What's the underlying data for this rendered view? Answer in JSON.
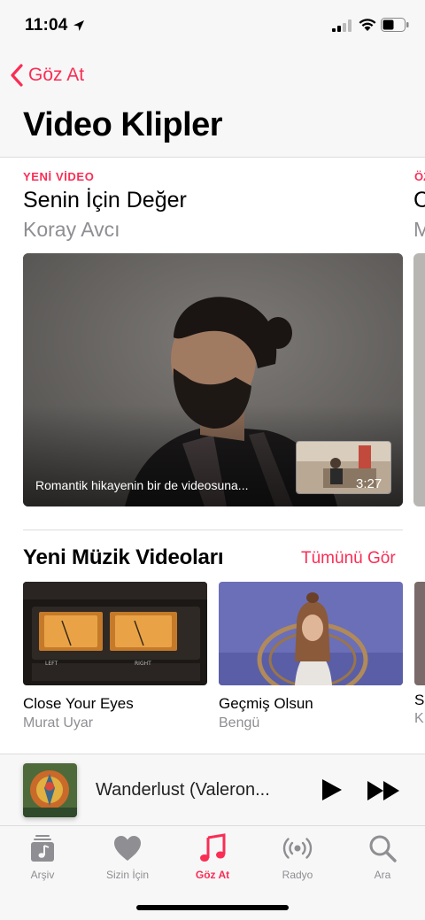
{
  "status_bar": {
    "time": "11:04"
  },
  "nav": {
    "back_label": "Göz At",
    "title": "Video Klipler"
  },
  "featured": {
    "eyebrow": "YENİ VİDEO",
    "title": "Senin İçin Değer",
    "artist": "Koray Avcı",
    "caption": "Romantik hikayenin bir de videosuna...",
    "duration": "3:27",
    "peek_eyebrow": "ÖZ",
    "peek_title": "C",
    "peek_artist": "M"
  },
  "new_videos": {
    "title": "Yeni Müzik Videoları",
    "see_all": "Tümünü Gör",
    "cards": [
      {
        "title": "Close Your Eyes",
        "artist": "Murat Uyar"
      },
      {
        "title": "Geçmiş Olsun",
        "artist": "Bengü"
      }
    ],
    "peek_card": {
      "title": "S",
      "artist": "K"
    }
  },
  "mini_player": {
    "title": "Wanderlust (Valeron..."
  },
  "tab_bar": {
    "tabs": [
      {
        "label": "Arşiv",
        "icon": "library-icon"
      },
      {
        "label": "Sizin İçin",
        "icon": "heart-icon"
      },
      {
        "label": "Göz At",
        "icon": "music-note-icon",
        "active": true
      },
      {
        "label": "Radyo",
        "icon": "radio-icon"
      },
      {
        "label": "Ara",
        "icon": "search-icon"
      }
    ]
  },
  "colors": {
    "accent": "#fa2d55",
    "secondary_text": "#8e8e93",
    "bar_background": "#f7f7f7"
  }
}
